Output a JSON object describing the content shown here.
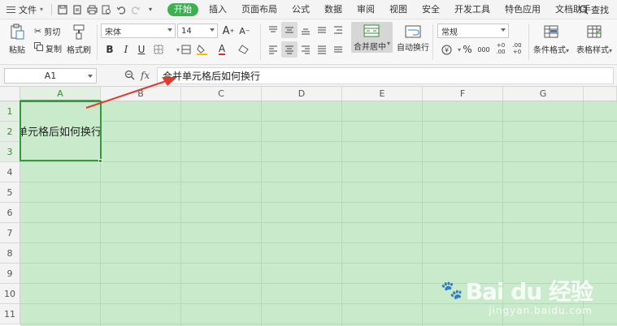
{
  "menubar": {
    "file_label": "文件",
    "tabs": [
      "开始",
      "插入",
      "页面布局",
      "公式",
      "数据",
      "审阅",
      "视图",
      "安全",
      "开发工具",
      "特色应用",
      "文档助手"
    ],
    "active_tab": "开始",
    "search_label": "查找"
  },
  "ribbon": {
    "paste": "粘贴",
    "cut": "剪切",
    "copy": "复制",
    "format_painter": "格式刷",
    "font_name": "宋体",
    "font_size": "14",
    "bold": "B",
    "italic": "I",
    "underline": "U",
    "font_color_letter": "A",
    "merge_center": "合并居中",
    "wrap_text": "自动换行",
    "number_format": "常规",
    "percent": "%",
    "thousands": "000",
    "inc_decimal": "+0 .00",
    "dec_decimal": ".00 +0",
    "conditional_format": "条件格式",
    "table_style": "表格样式",
    "accent_color": "#3cb150"
  },
  "formula_bar": {
    "name_box": "A1",
    "fx": "fx",
    "content": "合并单元格后如何换行"
  },
  "grid": {
    "columns": [
      "A",
      "B",
      "C",
      "D",
      "E",
      "F",
      "G"
    ],
    "rows": [
      "1",
      "2",
      "3",
      "4",
      "5",
      "6",
      "7",
      "8",
      "9",
      "10",
      "11"
    ],
    "selected_column": "A",
    "cell_a1_text": "合并单元格后如何换行",
    "sheet_color": "#c9ebcb",
    "selection_color": "#2e9b3d"
  },
  "watermark": {
    "brand": "Bai du 经验",
    "url": "jingyan.baidu.com"
  },
  "annotation_color": "#e53a2b"
}
